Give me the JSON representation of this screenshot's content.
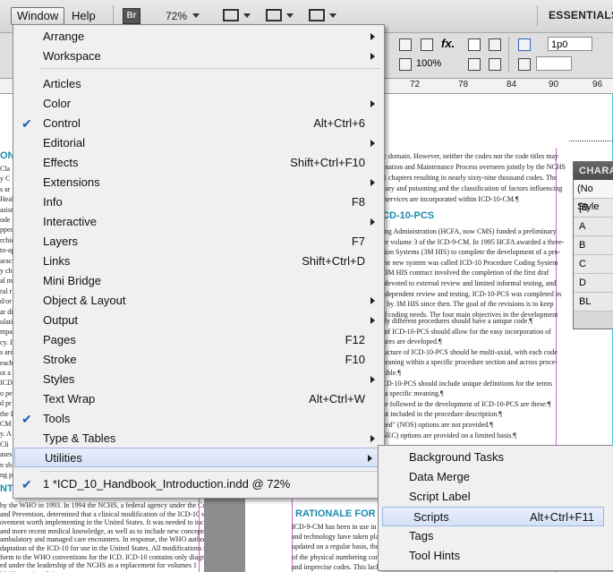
{
  "menubar": {
    "window_label": "Window",
    "help_label": "Help",
    "bridge_badge": "Br",
    "zoom": "72%",
    "workspace": "ESSENTIALS"
  },
  "control_panel": {
    "field_value": "1p0",
    "scale_value": "100%"
  },
  "ruler": {
    "ticks": [
      "72",
      "78",
      "84",
      "90",
      "96"
    ]
  },
  "char_panel": {
    "title": "CHARAC",
    "rows": [
      "(No Style",
      "[B",
      "A",
      "B",
      "C",
      "D",
      "BL"
    ]
  },
  "window_menu": {
    "items": [
      {
        "label": "Arrange",
        "shortcut": "",
        "submenu": true,
        "checked": false
      },
      {
        "label": "Workspace",
        "shortcut": "",
        "submenu": true,
        "checked": false
      },
      {
        "label": "Articles",
        "shortcut": "",
        "submenu": false,
        "checked": false
      },
      {
        "label": "Color",
        "shortcut": "",
        "submenu": true,
        "checked": false
      },
      {
        "label": "Control",
        "shortcut": "Alt+Ctrl+6",
        "submenu": false,
        "checked": true
      },
      {
        "label": "Editorial",
        "shortcut": "",
        "submenu": true,
        "checked": false
      },
      {
        "label": "Effects",
        "shortcut": "Shift+Ctrl+F10",
        "submenu": false,
        "checked": false
      },
      {
        "label": "Extensions",
        "shortcut": "",
        "submenu": true,
        "checked": false
      },
      {
        "label": "Info",
        "shortcut": "F8",
        "submenu": false,
        "checked": false
      },
      {
        "label": "Interactive",
        "shortcut": "",
        "submenu": true,
        "checked": false
      },
      {
        "label": "Layers",
        "shortcut": "F7",
        "submenu": false,
        "checked": false
      },
      {
        "label": "Links",
        "shortcut": "Shift+Ctrl+D",
        "submenu": false,
        "checked": false
      },
      {
        "label": "Mini Bridge",
        "shortcut": "",
        "submenu": false,
        "checked": false
      },
      {
        "label": "Object & Layout",
        "shortcut": "",
        "submenu": true,
        "checked": false
      },
      {
        "label": "Output",
        "shortcut": "",
        "submenu": true,
        "checked": false
      },
      {
        "label": "Pages",
        "shortcut": "F12",
        "submenu": false,
        "checked": false
      },
      {
        "label": "Stroke",
        "shortcut": "F10",
        "submenu": false,
        "checked": false
      },
      {
        "label": "Styles",
        "shortcut": "",
        "submenu": true,
        "checked": false
      },
      {
        "label": "Text Wrap",
        "shortcut": "Alt+Ctrl+W",
        "submenu": false,
        "checked": false
      },
      {
        "label": "Tools",
        "shortcut": "",
        "submenu": false,
        "checked": true
      },
      {
        "label": "Type & Tables",
        "shortcut": "",
        "submenu": true,
        "checked": false
      },
      {
        "label": "Utilities",
        "shortcut": "",
        "submenu": true,
        "checked": false,
        "highlighted": true
      }
    ],
    "document": {
      "label": "1 *ICD_10_Handbook_Introduction.indd @ 72%",
      "checked": true
    }
  },
  "utilities_menu": {
    "items": [
      {
        "label": "Background Tasks",
        "shortcut": ""
      },
      {
        "label": "Data Merge",
        "shortcut": ""
      },
      {
        "label": "Script Label",
        "shortcut": ""
      },
      {
        "label": "Scripts",
        "shortcut": "Alt+Ctrl+F11",
        "highlighted": true
      },
      {
        "label": "Tags",
        "shortcut": ""
      },
      {
        "label": "Tool Hints",
        "shortcut": ""
      }
    ]
  },
  "document": {
    "right_heading_1": "ICD-10-PCS",
    "right_heading_2": "RATIONALE FOR C",
    "left_heading_1": "ON",
    "left_heading_2": "NT",
    "right_lines_top": [
      "lic domain. However, neither the codes nor the code titles may",
      "dination and Maintenance Process overseen jointly by the NCHS",
      "21 chapters resulting in nearly sixty-nine thousand codes. The",
      "njury and poisoning and the classification of factors influencing",
      "h services are incorporated within ICD-10-CM.¶"
    ],
    "right_lines_mid": [
      "cing Administration (HCFA, now CMS) funded a preliminary",
      "ver volume 3 of the ICD-9-CM. In 1995 HCFA awarded a three-",
      "ation Systems (3M HIS) to complete the development of a pro-",
      "The new system was called ICD-10 Procedure Coding System",
      "e 3M HIS contract involved the completion of the first draf",
      "e devoted to external review and limited informal testing, and",
      "independent review and testing. ICD-10-PCS was completed in",
      "ly by 3M HIS since then. The goal of the revisions is to keep",
      "nd coding needs. The four main objectives in the development"
    ],
    "right_lines_low": [
      "ally different procedures should have a unique code.¶",
      "e of ICD-10-PCS should allow for the easy incorporation of",
      "dures are developed.¶",
      "tructure of ICD-10-PCS should be multi-axial, with each code",
      "meaning within a specific procedure section and across proce-",
      "ssible.¶",
      "ICD-10-PCS should include unique definitions for the terms",
      "g a specific meaning.¶",
      "ere followed in the development of ICD-10-PCS are these:¶",
      "not included in the procedure description.¶",
      "ified\" (NOS) options are not provided.¶",
      "(NEC) options are provided on a limited basis.¶"
    ],
    "right_lines_bottom": [
      "ICD-9-CM has been in use in the",
      "and technology have taken place",
      "updated on a regular basis, the cl",
      "of the physical numbering constr",
      "and imprecise codes. This lack o",
      "ach data on new technology, increased requirements for submission of documentation to support"
    ],
    "left_lines_bottom": [
      "by the WHO in 1993. In 1994 the NCHS, a federal agency under the Centers",
      "and Prevention, determined that a clinical modification of the ICD-10 would",
      "ovement worth implementing in the United States. It was needed to include",
      "and more recent medical knowledge, as well as to include new concepts and",
      "ambulatory and managed care encounters. In response, the WHO authorized",
      "daptation of the ICD-10 for use in the United States. All modifications to the",
      "form to the WHO conventions for the ICD. ICD-10 contains only diagnosis",
      "ed under the leadership of the NCHS as a replacement for volumes 1",
      "M (diagnosis only)."
    ],
    "left_fragments": [
      "Cla",
      "y C",
      "s ar",
      "Heal",
      "asist",
      "ode",
      "pped",
      "rchie",
      "to-ap",
      "aract",
      "y ch",
      "al m",
      "ral r",
      "d/or",
      "ar di",
      "ulatic",
      "mpa",
      "cy. I",
      "s are",
      "each",
      "ot a",
      "ICD",
      "o pe",
      "d pr",
      "the I",
      "CM a",
      "y. A",
      "Cli",
      "ases",
      "n sh",
      "ng p"
    ]
  },
  "colors": {
    "heading_teal": "#1a8cab",
    "margin_magenta": "#c86cc8",
    "guide_cyan": "#49c4e0",
    "check_blue": "#1e5fae",
    "highlight": "#d5e1f7"
  }
}
